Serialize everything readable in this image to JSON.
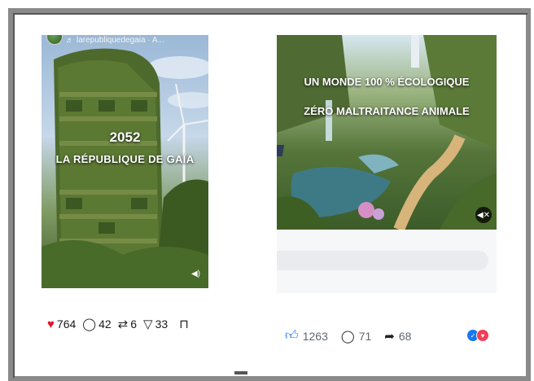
{
  "left_post": {
    "account": "larepubliquedegaia · A...",
    "title_line1": "2052",
    "title_line2": "LA RÉPUBLIQUE DE GAÏA",
    "likes": "764",
    "comments": "42",
    "reposts": "6",
    "shares": "33",
    "icons": {
      "like": "heart-icon",
      "comment": "comment-bubble-icon",
      "repost": "repost-icon",
      "share": "send-icon",
      "save": "bookmark-icon",
      "audio": "music-note-icon",
      "sound": "speaker-icon"
    }
  },
  "right_post": {
    "title_line1": "UN MONDE 100 % ÉCOLOGIQUE",
    "title_line2": "ZÉRO MALTRAITANCE ANIMALE",
    "likes": "1263",
    "comments": "71",
    "shares": "68",
    "icons": {
      "like": "thumbs-up-icon",
      "comment": "comment-bubble-icon",
      "share": "share-arrow-icon",
      "mute": "speaker-muted-icon",
      "reactions": [
        "like-reaction-icon",
        "love-reaction-icon"
      ]
    }
  },
  "colors": {
    "heart": "#e0162b",
    "facebook_blue": "#1877f2",
    "love_red": "#f33e58",
    "frame_gray": "#8a8a8a"
  }
}
